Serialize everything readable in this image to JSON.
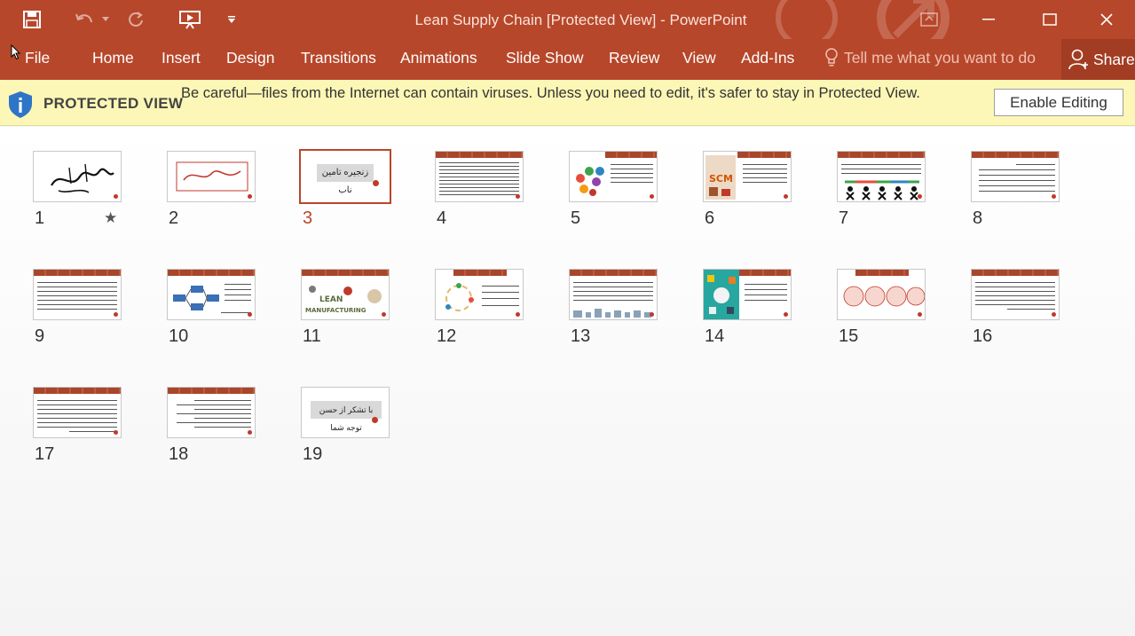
{
  "app": {
    "window_title": "Lean Supply Chain [Protected View] - PowerPoint",
    "accent_color": "#b7472a"
  },
  "quick_access": {
    "icons": [
      "save-icon",
      "undo-icon",
      "undo-dropdown-icon",
      "redo-icon",
      "start-from-beginning-icon",
      "customize-qat-icon"
    ]
  },
  "window_controls": {
    "icons": [
      "ribbon-display-options-icon",
      "minimize-icon",
      "maximize-icon",
      "close-icon"
    ]
  },
  "ribbon": {
    "tabs": [
      "File",
      "Home",
      "Insert",
      "Design",
      "Transitions",
      "Animations",
      "Slide Show",
      "Review",
      "View",
      "Add-Ins"
    ],
    "tell_me": "Tell me what you want to do",
    "share": "Share"
  },
  "protected_view": {
    "title": "PROTECTED VIEW",
    "message": "Be careful—files from the Internet can contain viruses. Unless you need to edit, it's safer to stay in Protected View.",
    "button": "Enable Editing",
    "bar_color": "#fcf7b6"
  },
  "slides": [
    {
      "number": "1",
      "kind": "calligraphy-black",
      "star": "★"
    },
    {
      "number": "2",
      "kind": "calligraphy-red"
    },
    {
      "number": "3",
      "kind": "title-box",
      "caption": "زنجیره تامین ناب",
      "selected": true
    },
    {
      "number": "4",
      "kind": "dense-text"
    },
    {
      "number": "5",
      "kind": "text-circles"
    },
    {
      "number": "6",
      "kind": "text-image"
    },
    {
      "number": "7",
      "kind": "text-people"
    },
    {
      "number": "8",
      "kind": "text-right"
    },
    {
      "number": "9",
      "kind": "text-wide"
    },
    {
      "number": "10",
      "kind": "diagram"
    },
    {
      "number": "11",
      "kind": "lean-image",
      "caption": "LEAN MANUFACTURING"
    },
    {
      "number": "12",
      "kind": "cycle"
    },
    {
      "number": "13",
      "kind": "text-icons"
    },
    {
      "number": "14",
      "kind": "teal-image"
    },
    {
      "number": "15",
      "kind": "circles-row"
    },
    {
      "number": "16",
      "kind": "text-right"
    },
    {
      "number": "17",
      "kind": "text-wide"
    },
    {
      "number": "18",
      "kind": "text-list"
    },
    {
      "number": "19",
      "kind": "title-box",
      "caption": "با تشکر از حسن توجه شما"
    }
  ]
}
